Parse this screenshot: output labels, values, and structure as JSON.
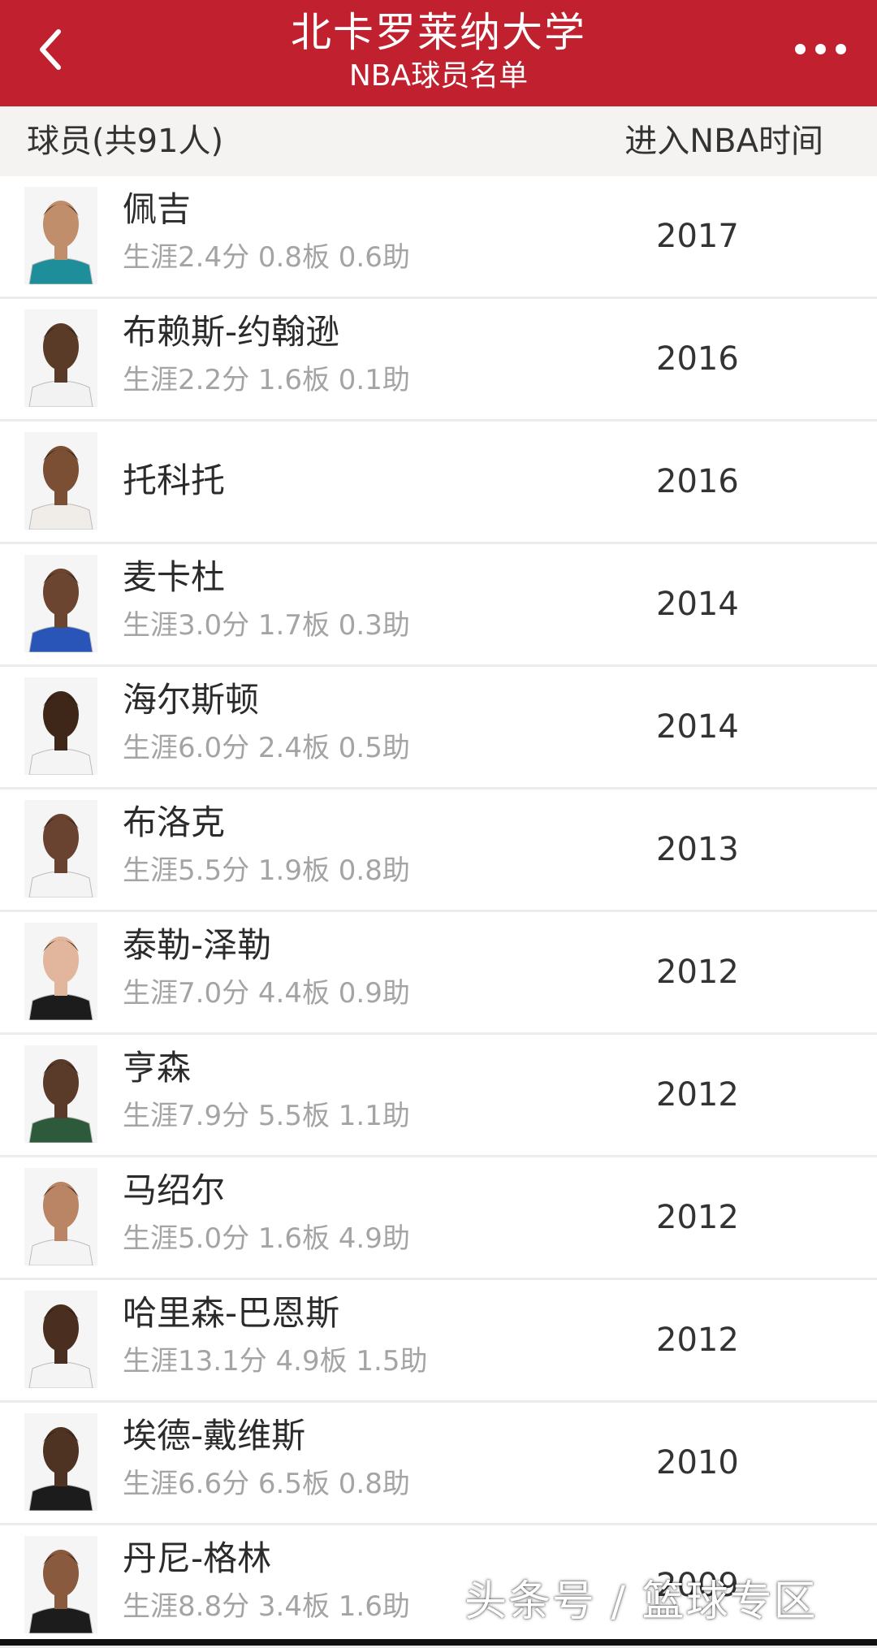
{
  "header": {
    "title": "北卡罗莱纳大学",
    "subtitle": "NBA球员名单",
    "back_icon": "chevron-left-icon",
    "more_icon": "more-dots-icon",
    "bg_color": "#c1202e"
  },
  "columns": {
    "left": "球员(共91人)",
    "right": "进入NBA时间"
  },
  "players": [
    {
      "name": "佩吉",
      "stats": "生涯2.4分 0.8板 0.6助",
      "year": "2017",
      "jersey": "#1e8f9a",
      "skin": "#c08e6a"
    },
    {
      "name": "布赖斯-约翰逊",
      "stats": "生涯2.2分 1.6板 0.1助",
      "year": "2016",
      "jersey": "#f2f2f2",
      "skin": "#5a3b28"
    },
    {
      "name": "托科托",
      "stats": "",
      "year": "2016",
      "jersey": "#f0ece8",
      "skin": "#7a4f34"
    },
    {
      "name": "麦卡杜",
      "stats": "生涯3.0分 1.7板 0.3助",
      "year": "2014",
      "jersey": "#2a55b8",
      "skin": "#6b4530"
    },
    {
      "name": "海尔斯顿",
      "stats": "生涯6.0分 2.4板 0.5助",
      "year": "2014",
      "jersey": "#f4f4f4",
      "skin": "#3e2718"
    },
    {
      "name": "布洛克",
      "stats": "生涯5.5分 1.9板 0.8助",
      "year": "2013",
      "jersey": "#f4f4f4",
      "skin": "#6a4330"
    },
    {
      "name": "泰勒-泽勒",
      "stats": "生涯7.0分 4.4板 0.9助",
      "year": "2012",
      "jersey": "#1c1c1c",
      "skin": "#e2b69c"
    },
    {
      "name": "亨森",
      "stats": "生涯7.9分 5.5板 1.1助",
      "year": "2012",
      "jersey": "#2d5a3a",
      "skin": "#5a3a28"
    },
    {
      "name": "马绍尔",
      "stats": "生涯5.0分 1.6板 4.9助",
      "year": "2012",
      "jersey": "#f4f4f4",
      "skin": "#b98565"
    },
    {
      "name": "哈里森-巴恩斯",
      "stats": "生涯13.1分 4.9板 1.5助",
      "year": "2012",
      "jersey": "#f4f4f4",
      "skin": "#4a2f20"
    },
    {
      "name": "埃德-戴维斯",
      "stats": "生涯6.6分 6.5板 0.8助",
      "year": "2010",
      "jersey": "#1c1c1c",
      "skin": "#4e3222"
    },
    {
      "name": "丹尼-格林",
      "stats": "生涯8.8分 3.4板 1.6助",
      "year": "2009",
      "jersey": "#1c1c1c",
      "skin": "#8a5a3e"
    }
  ],
  "watermark": "头条号 / 篮球专区"
}
